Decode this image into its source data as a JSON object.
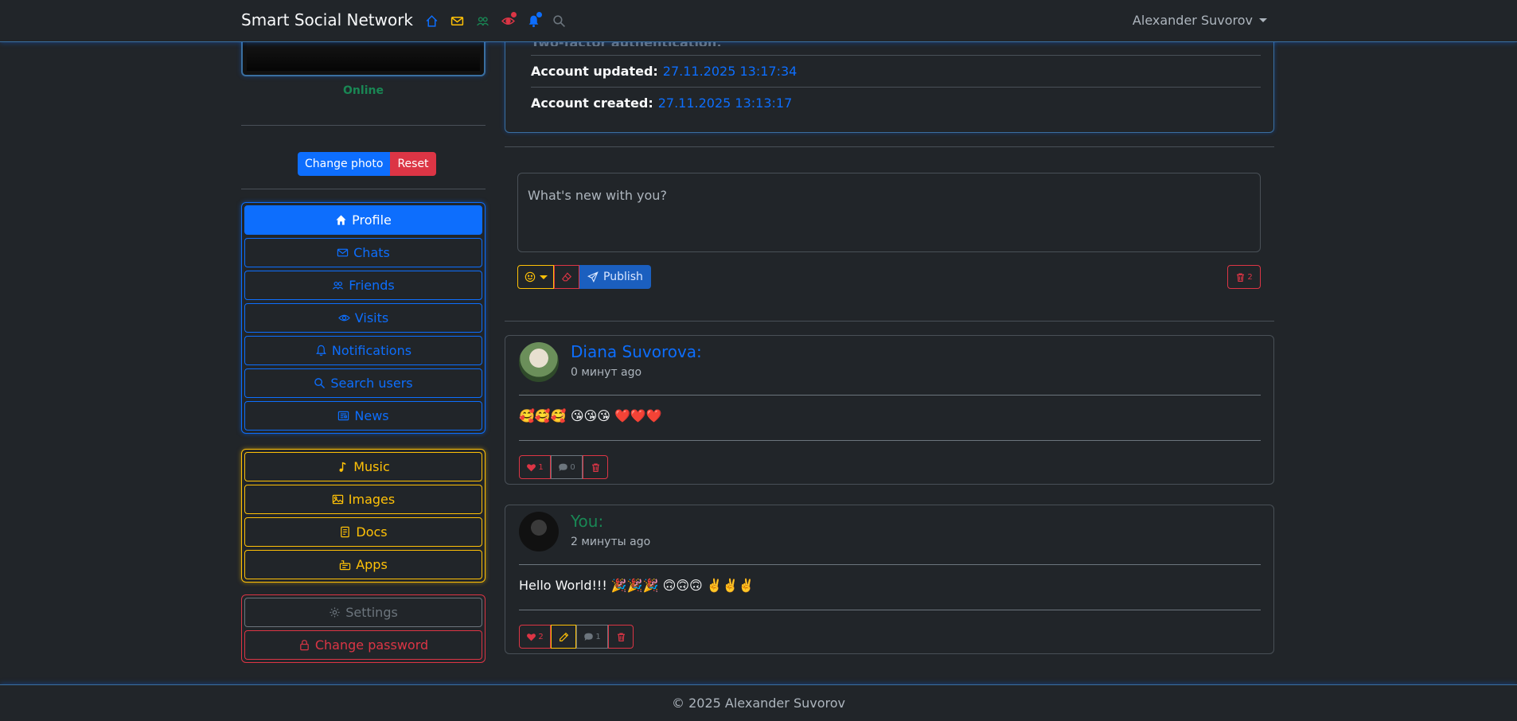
{
  "app": {
    "title": "Smart Social Network",
    "user_name": "Alexander Suvorov"
  },
  "colors": {
    "primary": "#0d6efd",
    "warning": "#ffc107",
    "danger": "#dc3545",
    "success": "#198754",
    "background": "#212529"
  },
  "nav_icons": [
    "home-icon",
    "envelope-icon",
    "people-icon",
    "eye-icon",
    "bell-icon",
    "search-icon"
  ],
  "profile": {
    "status": "Online",
    "change_photo_label": "Change photo",
    "reset_label": "Reset",
    "account_updated_label": "Account updated:",
    "account_updated_value": "27.11.2025 13:17:34",
    "account_created_label": "Account created:",
    "account_created_value": "27.11.2025 13:13:17",
    "partial_row_label": "Two-factor authentication:"
  },
  "menu": {
    "main": [
      {
        "label": "Profile",
        "icon": "house-icon",
        "active": true
      },
      {
        "label": "Chats",
        "icon": "envelope-icon"
      },
      {
        "label": "Friends",
        "icon": "people-icon"
      },
      {
        "label": "Visits",
        "icon": "eye-icon"
      },
      {
        "label": "Notifications",
        "icon": "bell-icon"
      },
      {
        "label": "Search users",
        "icon": "search-icon"
      },
      {
        "label": "News",
        "icon": "newspaper-icon"
      }
    ],
    "media": [
      {
        "label": "Music",
        "icon": "music-note-icon"
      },
      {
        "label": "Images",
        "icon": "image-icon"
      },
      {
        "label": "Docs",
        "icon": "document-icon"
      },
      {
        "label": "Apps",
        "icon": "apps-icon"
      }
    ],
    "account": [
      {
        "label": "Settings",
        "icon": "gear-icon"
      },
      {
        "label": "Change password",
        "icon": "lock-icon"
      }
    ]
  },
  "composer": {
    "placeholder": "What's new with you?",
    "publish_label": "Publish",
    "trash_count": "2"
  },
  "posts": [
    {
      "author": "Diana Suvorova:",
      "time": "0 минут ago",
      "text": "🥰🥰🥰 😘😘😘 ❤️❤️❤️",
      "likes": "1",
      "comments": "0"
    },
    {
      "author": "You:",
      "time": "2 минуты ago",
      "text": "Hello World!!! 🎉🎉🎉 🙃🙃🙃 ✌️✌️✌️",
      "likes": "2",
      "comments": "1"
    }
  ],
  "footer": {
    "text": "© 2025 Alexander Suvorov"
  }
}
